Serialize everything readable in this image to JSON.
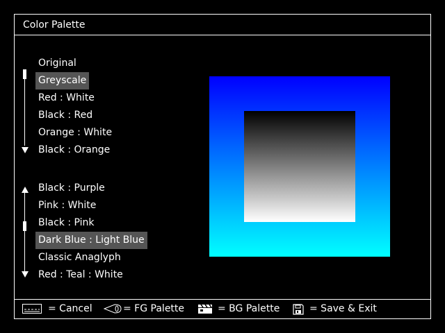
{
  "window": {
    "title": "Color Palette"
  },
  "fg_list": {
    "items": [
      "Original",
      "Greyscale",
      "Red : White",
      "Black : Red",
      "Orange : White",
      "Black : Orange"
    ],
    "selected": 1
  },
  "bg_list": {
    "items": [
      "Black : Purple",
      "Pink : White",
      "Black : Pink",
      "Dark Blue : Light Blue",
      "Classic Anaglyph",
      "Red : Teal : White"
    ],
    "selected": 3
  },
  "preview": {
    "outer_gradient": [
      "#0000ff",
      "#00ffff"
    ],
    "inner_gradient": [
      "#000000",
      "#ffffff"
    ]
  },
  "footer": {
    "cancel": {
      "icon": "keyboard-icon",
      "label": "= Cancel"
    },
    "fg": {
      "icon": "nunchuk-icon",
      "label": "= FG Palette"
    },
    "bg": {
      "icon": "clapperboard-icon",
      "label": "= BG Palette"
    },
    "save": {
      "icon": "floppy-disk-icon",
      "label": "= Save & Exit"
    }
  }
}
